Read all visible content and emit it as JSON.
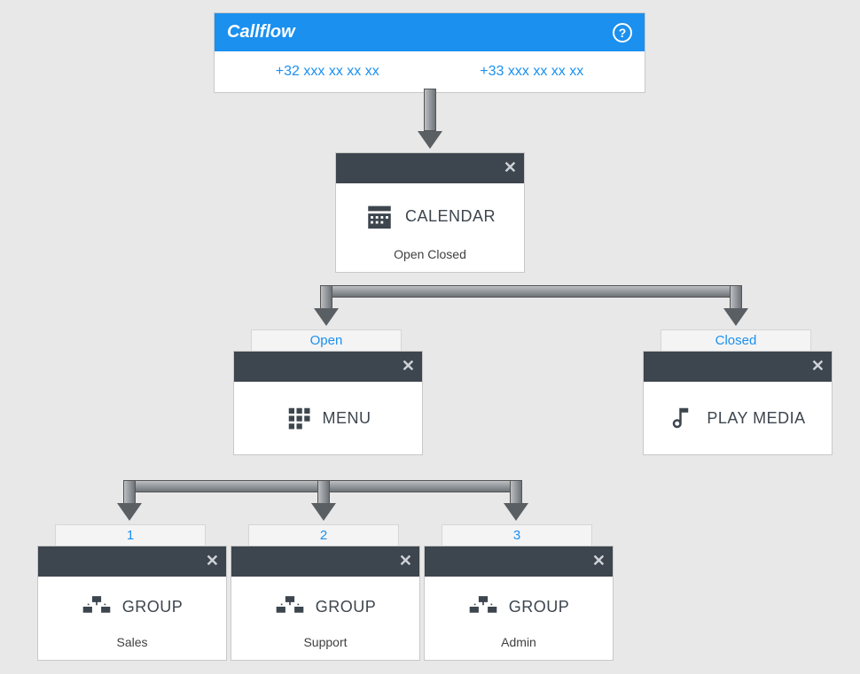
{
  "root": {
    "title": "Callflow",
    "help_tooltip": "?",
    "numbers": [
      "+32 xxx xx xx xx",
      "+33 xxx xx xx xx"
    ]
  },
  "calendar": {
    "label": "CALENDAR",
    "sub": "Open Closed",
    "close": "✕"
  },
  "branches": {
    "open_tab": "Open",
    "closed_tab": "Closed"
  },
  "menu": {
    "label": "MENU",
    "close": "✕"
  },
  "playmedia": {
    "label": "PLAY MEDIA",
    "close": "✕"
  },
  "menu_options": [
    {
      "tab": "1",
      "label": "GROUP",
      "sub": "Sales",
      "close": "✕"
    },
    {
      "tab": "2",
      "label": "GROUP",
      "sub": "Support",
      "close": "✕"
    },
    {
      "tab": "3",
      "label": "GROUP",
      "sub": "Admin",
      "close": "✕"
    }
  ]
}
